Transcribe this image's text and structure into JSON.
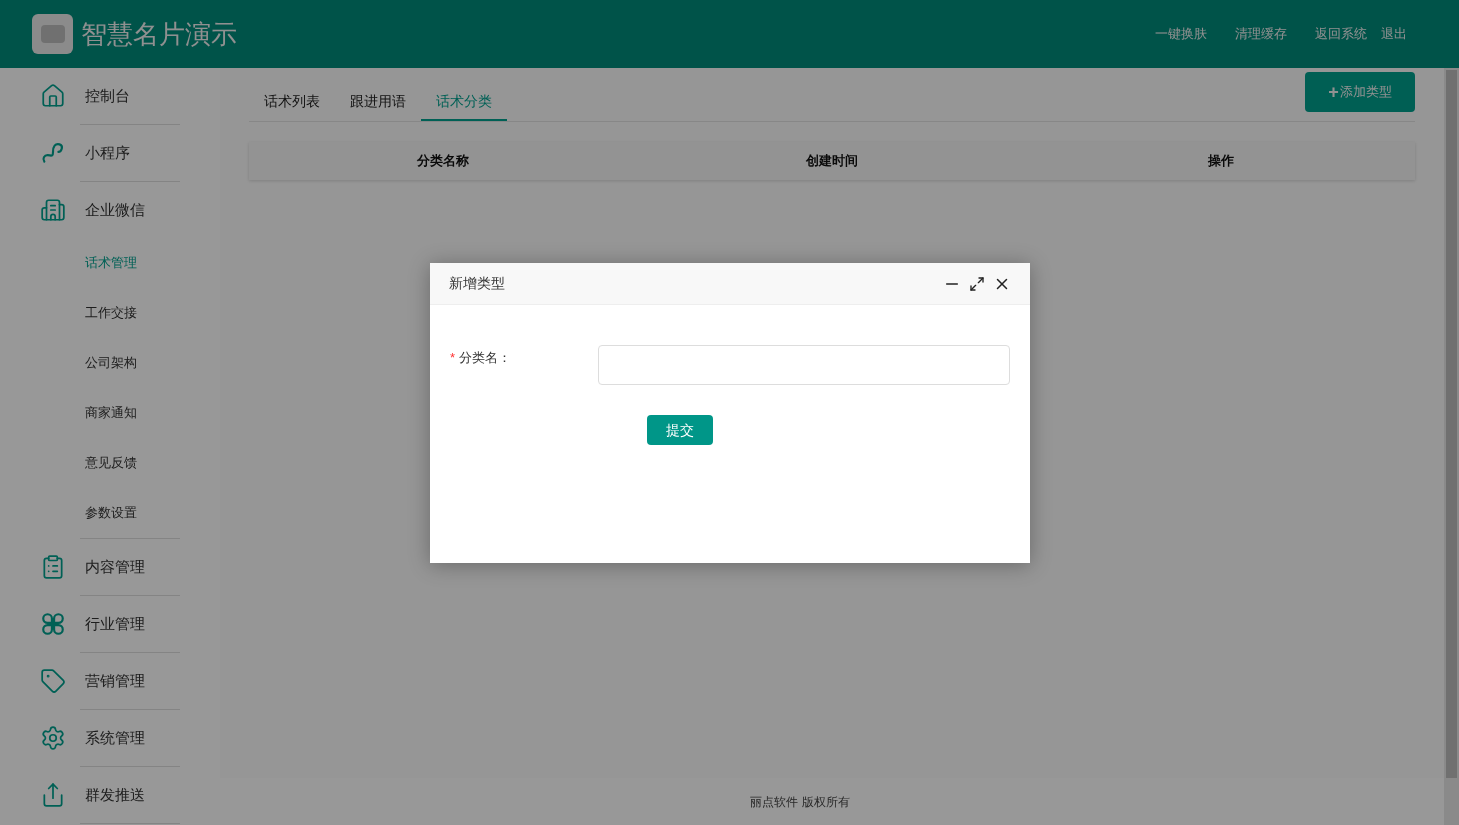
{
  "header": {
    "title": "智慧名片演示",
    "actions": [
      "一键换肤",
      "清理缓存",
      "返回系统",
      "退出"
    ]
  },
  "sidebar": {
    "items": [
      {
        "label": "控制台"
      },
      {
        "label": "小程序"
      },
      {
        "label": "企业微信",
        "children": [
          {
            "label": "话术管理",
            "selected": true
          },
          {
            "label": "工作交接",
            "selected": false
          },
          {
            "label": "公司架构",
            "selected": false
          },
          {
            "label": "商家通知",
            "selected": false
          },
          {
            "label": "意见反馈",
            "selected": false
          },
          {
            "label": "参数设置",
            "selected": false
          }
        ]
      },
      {
        "label": "内容管理"
      },
      {
        "label": "行业管理"
      },
      {
        "label": "营销管理"
      },
      {
        "label": "系统管理"
      },
      {
        "label": "群发推送"
      }
    ]
  },
  "tabs": [
    {
      "label": "话术列表",
      "selected": false
    },
    {
      "label": "跟进用语",
      "selected": false
    },
    {
      "label": "话术分类",
      "selected": true
    }
  ],
  "add_button": {
    "icon": "+",
    "label": "添加类型"
  },
  "table": {
    "columns": [
      "分类名称",
      "创建时间",
      "操作"
    ]
  },
  "footer": "丽点软件 版权所有",
  "dialog": {
    "title": "新增类型",
    "field": {
      "required_mark": "*",
      "label": "分类名："
    },
    "submit": "提交"
  }
}
